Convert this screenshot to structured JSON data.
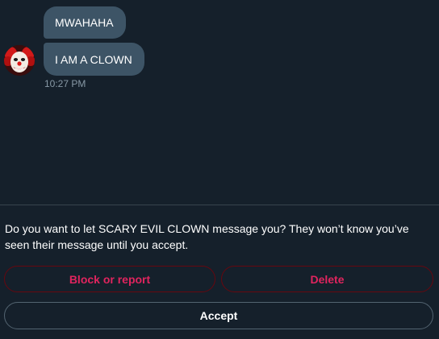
{
  "conversation": {
    "messages": [
      {
        "text": "MWAHAHA"
      },
      {
        "text": "I AM A CLOWN"
      }
    ],
    "timestamp": "10:27 PM",
    "sender_avatar": "clown-avatar"
  },
  "message_request": {
    "prompt": "Do you want to let SCARY EVIL CLOWN message you? They won’t know you’ve seen their message until you accept.",
    "block_label": "Block or report",
    "delete_label": "Delete",
    "accept_label": "Accept"
  },
  "colors": {
    "background": "#15202b",
    "bubble": "#3d5466",
    "danger": "#e0245e",
    "muted": "#8899a6"
  }
}
